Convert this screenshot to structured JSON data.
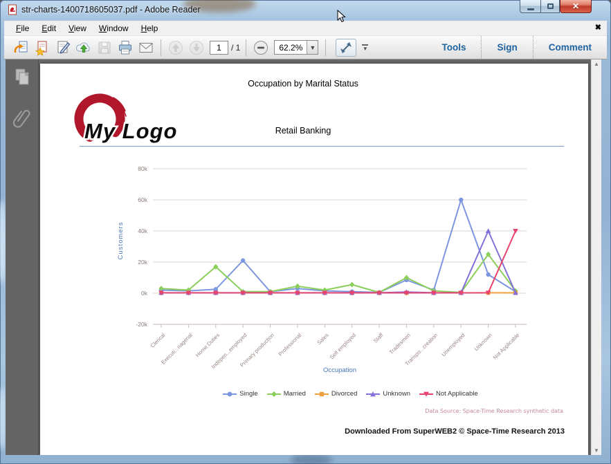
{
  "window": {
    "title": "str-charts-1400718605037.pdf - Adobe Reader"
  },
  "menu": {
    "items": [
      {
        "label": "File"
      },
      {
        "label": "Edit"
      },
      {
        "label": "View"
      },
      {
        "label": "Window"
      },
      {
        "label": "Help"
      }
    ]
  },
  "icons": {
    "doc_close": "✖",
    "caption_close": "✕",
    "zoom_dropdown": "▼",
    "overflow_chevron": "▼",
    "scroll_up": "▲",
    "scroll_down": "▼"
  },
  "toolbar": {
    "page_current": "1",
    "page_total": "/ 1",
    "zoom_level": "62.2%",
    "tools_label": "Tools",
    "sign_label": "Sign",
    "comment_label": "Comment"
  },
  "document": {
    "page_title": "Occupation by Marital Status",
    "page_subtitle": "Retail Banking",
    "logo_text": "My Logo",
    "data_source": "Data Source: Space-Time Research synthetic data",
    "download_footer": "Downloaded From SuperWEB2 © Space-Time Research 2013"
  },
  "chart_data": {
    "type": "line",
    "title": "Occupation by Marital Status",
    "subtitle": "Retail Banking",
    "xlabel": "Occupation",
    "ylabel": "Customers",
    "ylim": [
      -20000,
      90000
    ],
    "grid": true,
    "legend_position": "bottom",
    "yticks": [
      {
        "value": 80000,
        "label": "80k"
      },
      {
        "value": 60000,
        "label": "60k"
      },
      {
        "value": 40000,
        "label": "40k"
      },
      {
        "value": 20000,
        "label": "20k"
      },
      {
        "value": 0,
        "label": "0k"
      },
      {
        "value": -20000,
        "label": "-20k"
      }
    ],
    "categories": [
      "Clerical",
      "Executi...nagerial",
      "Home Duties",
      "Indepen...employed",
      "Primary production",
      "Professional",
      "Sales",
      "Self employed",
      "Staff",
      "Tradesmen",
      "Transpo...creation",
      "Unemployed",
      "Unknown",
      "Not Applicable"
    ],
    "series": [
      {
        "name": "Single",
        "color": "#7d96e0",
        "marker": "circle",
        "values": [
          2000,
          1500,
          2500,
          21000,
          1000,
          3000,
          1500,
          1000,
          500,
          8500,
          2000,
          60000,
          12000,
          1000
        ]
      },
      {
        "name": "Married",
        "color": "#8bce5a",
        "marker": "diamond",
        "values": [
          3000,
          2000,
          17000,
          1000,
          1000,
          4500,
          2000,
          5500,
          500,
          10000,
          1500,
          500,
          25000,
          1500
        ]
      },
      {
        "name": "Divorced",
        "color": "#f0a03f",
        "marker": "square",
        "values": [
          200,
          200,
          200,
          200,
          200,
          200,
          200,
          200,
          200,
          200,
          200,
          200,
          300,
          200
        ]
      },
      {
        "name": "Unknown",
        "color": "#8470d8",
        "marker": "triangle-up",
        "values": [
          300,
          300,
          300,
          300,
          300,
          300,
          300,
          300,
          300,
          800,
          300,
          300,
          40000,
          300
        ]
      },
      {
        "name": "Not Applicable",
        "color": "#e8436e",
        "marker": "triangle-down",
        "values": [
          200,
          200,
          200,
          200,
          200,
          200,
          200,
          200,
          200,
          200,
          200,
          200,
          300,
          40000
        ]
      }
    ]
  }
}
